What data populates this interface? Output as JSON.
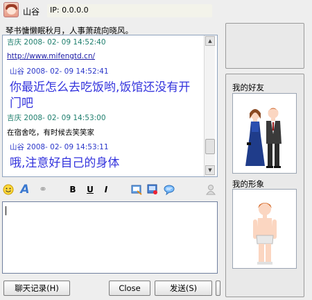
{
  "header": {
    "nickname": "山谷",
    "ip": "IP: 0.0.0.0"
  },
  "signature": "琴书慵懒眠秋月，人事萧疏向晓风。",
  "chat": {
    "messages": [
      {
        "header": "吉庆 2008- 02- 09 14:52:40"
      },
      {
        "text": "http://www.mifengtd.cn/"
      },
      {
        "header": "山谷 2008- 02- 09 14:52:41"
      },
      {
        "text_line1": "你最近怎么去吃饭哟,饭馆还没有开",
        "text_line2": "门吧"
      },
      {
        "header": "吉庆 2008- 02- 09 14:53:00"
      },
      {
        "text": "在宿舍吃，有时候去笑笑家"
      },
      {
        "header": "山谷 2008- 02- 09 14:53:11"
      },
      {
        "text": "哦,注意好自己的身体"
      }
    ]
  },
  "toolbar": {
    "bold": "B",
    "underline": "U",
    "italic": "I",
    "font": "A"
  },
  "input": {
    "value": ""
  },
  "buttons": {
    "history": "聊天记录(H)",
    "close": "Close",
    "send": "发送(S)"
  },
  "panel": {
    "friend_title": "我的好友",
    "self_title": "我的形象"
  }
}
